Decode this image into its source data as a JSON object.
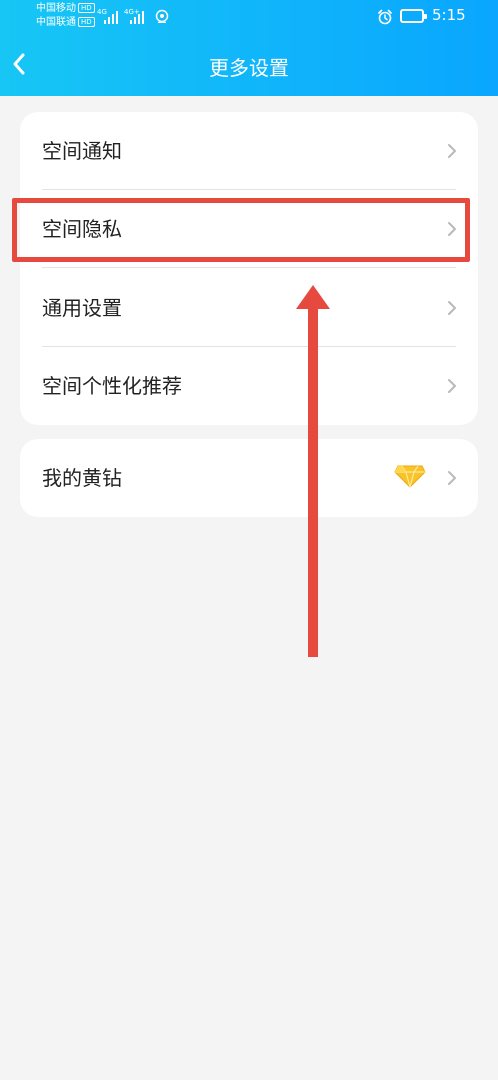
{
  "status_bar": {
    "carrier1": "中国移动",
    "carrier2": "中国联通",
    "hd_badge": "HD",
    "network1": "4G",
    "network2": "4G+",
    "time": "5:15",
    "icons": [
      "alarm-icon",
      "battery-icon",
      "wifi-icon",
      "signal-icon"
    ]
  },
  "header": {
    "title": "更多设置",
    "back_icon": "chevron-left-icon"
  },
  "settings_group1": [
    {
      "label": "空间通知"
    },
    {
      "label": "空间隐私"
    },
    {
      "label": "通用设置"
    },
    {
      "label": "空间个性化推荐"
    }
  ],
  "settings_group2": [
    {
      "label": "我的黄钻",
      "icon": "yellow-diamond-icon"
    }
  ],
  "annotation": {
    "highlighted_item": "空间隐私",
    "highlight_color": "#e64a3f"
  },
  "colors": {
    "header_gradient_start": "#17c6f5",
    "header_gradient_end": "#0aa6ff",
    "background": "#f4f4f4",
    "card": "#ffffff",
    "text": "#222222",
    "chevron": "#b9b9b9"
  }
}
